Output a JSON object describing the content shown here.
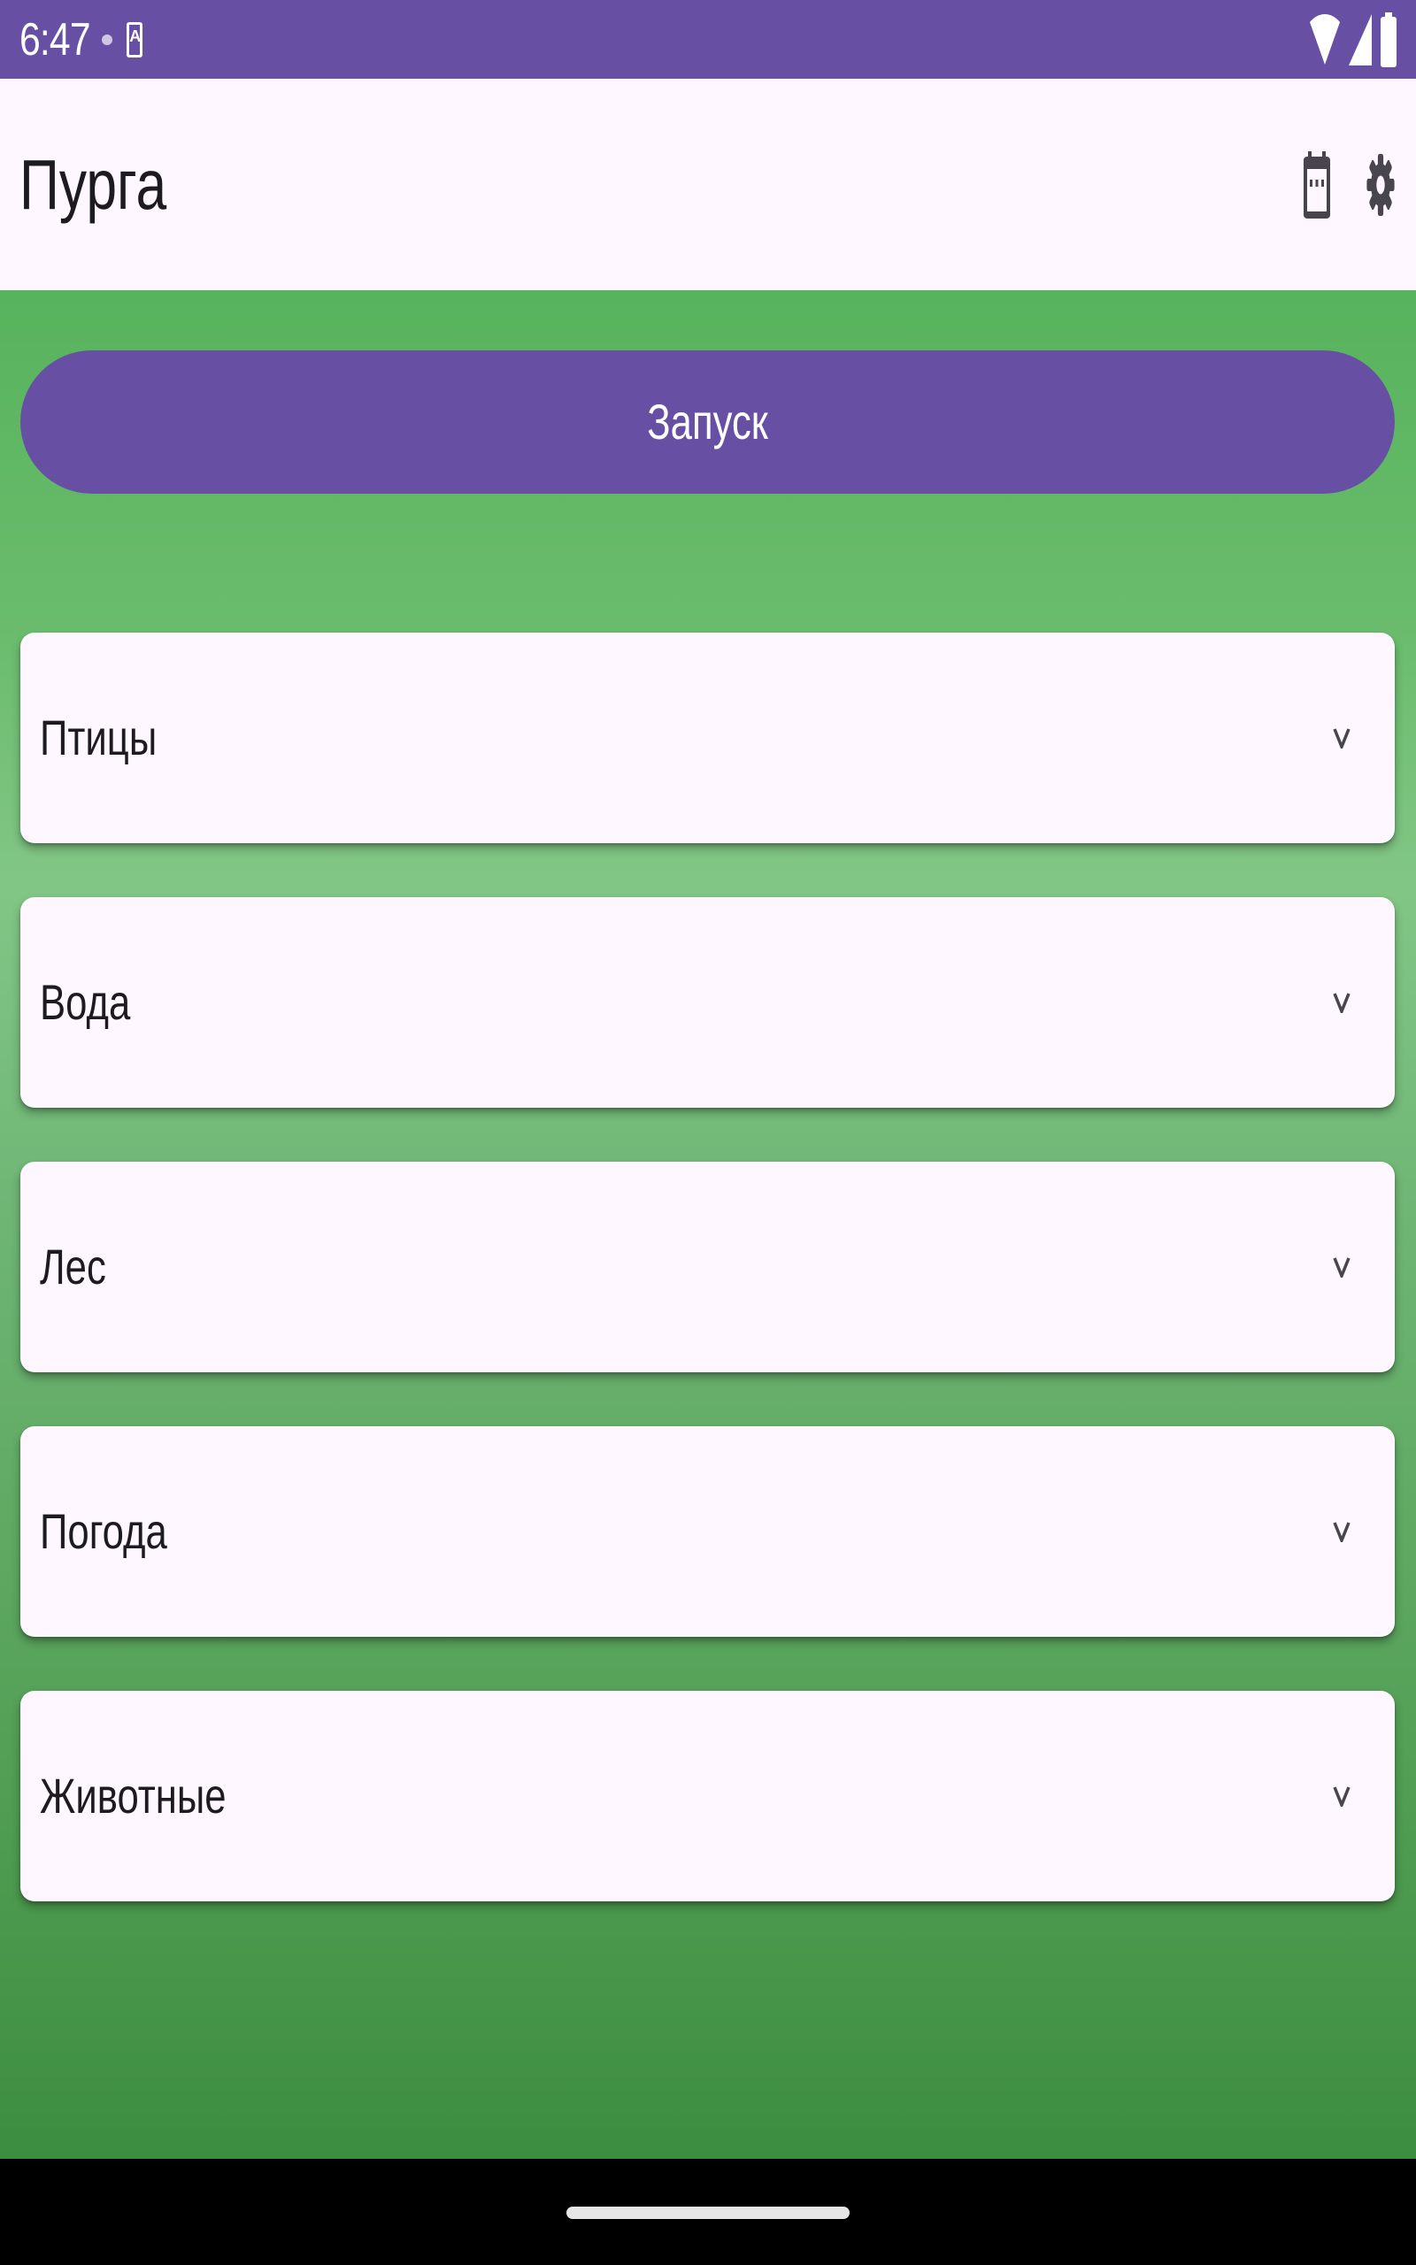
{
  "status_bar": {
    "time": "6:47",
    "icons": [
      "notification-dot-icon",
      "keyboard-notification-icon",
      "wifi-icon",
      "signal-icon",
      "battery-icon"
    ]
  },
  "app_bar": {
    "title": "Пурга",
    "actions": [
      "calendar-icon",
      "settings-gear-icon"
    ]
  },
  "main": {
    "launch_label": "Запуск",
    "categories": [
      {
        "label": "Птицы",
        "icon": "chevron-down-icon"
      },
      {
        "label": "Вода",
        "icon": "chevron-down-icon"
      },
      {
        "label": "Лес",
        "icon": "chevron-down-icon"
      },
      {
        "label": "Погода",
        "icon": "chevron-down-icon"
      },
      {
        "label": "Животные",
        "icon": "chevron-down-icon"
      }
    ]
  },
  "colors": {
    "primary": "#6750A4",
    "surface": "#FEF7FF",
    "background_green": "#5ea861"
  }
}
